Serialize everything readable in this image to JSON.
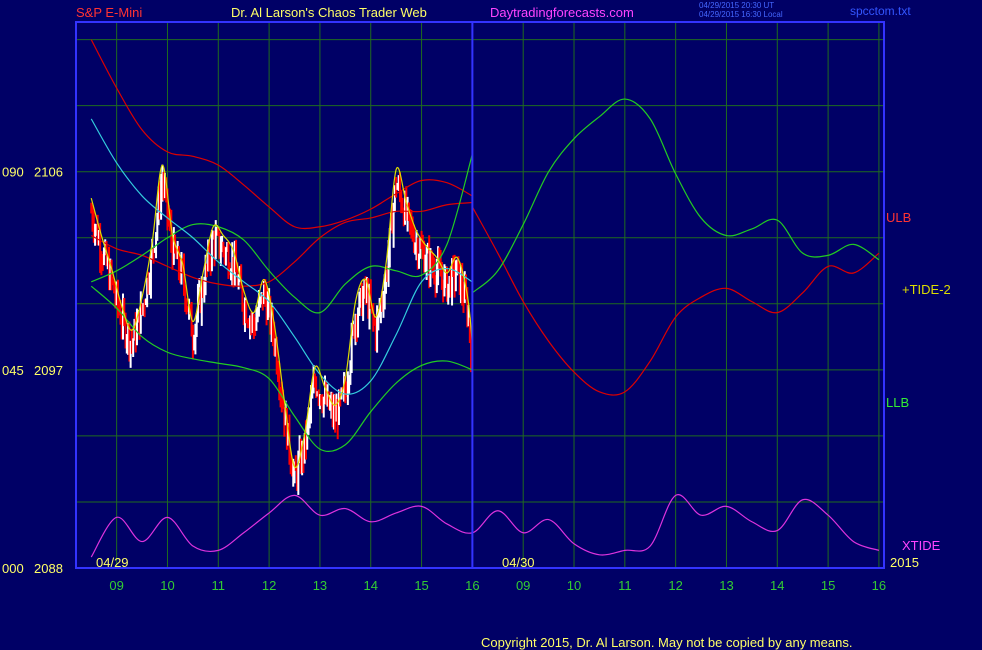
{
  "header": {
    "symbol": "S&P E-Mini",
    "title": "Dr. Al Larson's Chaos Trader Web",
    "site": "Daytradingforecasts.com",
    "stamp_line1": "04/29/2015 20:30 UT",
    "stamp_line2": "04/29/2015 16:30 Local",
    "filename": "spcctom.txt"
  },
  "footer": {
    "copyright": "Copyright 2015, Dr. Al Larson. May not be copied by any means."
  },
  "colors": {
    "background": "#000066",
    "frame": "#3333ff",
    "grid": "#1f6b1f",
    "red_line": "#dd0000",
    "green_line": "#22cc22",
    "cyan_line": "#33ccdd",
    "yellow_line": "#dddd00",
    "magenta_line": "#dd33dd",
    "bar_up": "#ffffff",
    "bar_down": "#ff0000",
    "time_labels": "#33cc33"
  },
  "chart_data": {
    "type": "line",
    "y_axis_labels": [
      {
        "left": "090",
        "right": "2106"
      },
      {
        "left": "045",
        "right": "2097"
      },
      {
        "left": "000",
        "right": "2088"
      }
    ],
    "ylim": [
      2088,
      2112.8
    ],
    "x_hour_labels": [
      "09",
      "10",
      "11",
      "12",
      "13",
      "14",
      "15",
      "16",
      "09",
      "10",
      "11",
      "12",
      "13",
      "14",
      "15",
      "16"
    ],
    "date_labels": [
      "04/29",
      "04/30",
      "2015"
    ],
    "series_labels": {
      "ulb": "ULB",
      "llb": "LLB",
      "tide": "+TIDE-2",
      "xtide": "XTIDE"
    },
    "series": [
      {
        "name": "ULB",
        "x": [
          8.5,
          9,
          9.5,
          10,
          10.5,
          11,
          11.5,
          12,
          12.5,
          13,
          13.5,
          14,
          14.5,
          15,
          15.5,
          16
        ],
        "y": [
          2112.0,
          2109.8,
          2107.9,
          2106.9,
          2106.7,
          2106.3,
          2105.4,
          2104.4,
          2103.5,
          2103.5,
          2103.8,
          2104.3,
          2105.0,
          2105.6,
          2105.5,
          2104.9
        ]
      },
      {
        "name": "Projection (red)",
        "x": [
          16,
          16.5,
          17,
          17.5,
          18,
          18.5,
          19,
          19.5,
          20,
          20.5,
          21,
          21.5,
          22,
          22.5,
          23,
          23.5,
          24
        ],
        "y": [
          2104.4,
          2102.3,
          2100.1,
          2098.3,
          2096.9,
          2096.0,
          2096.0,
          2097.4,
          2099.4,
          2100.3,
          2100.7,
          2100.1,
          2099.6,
          2100.5,
          2101.7,
          2101.4,
          2102.3
        ]
      },
      {
        "name": "Projection (green)",
        "x": [
          16,
          16.5,
          17,
          17.5,
          18,
          18.5,
          19,
          19.5,
          20,
          20.5,
          21,
          21.5,
          22,
          22.5,
          23,
          23.5,
          24
        ],
        "y": [
          2100.5,
          2101.5,
          2103.6,
          2106.0,
          2107.5,
          2108.5,
          2109.3,
          2108.4,
          2105.9,
          2103.9,
          2103.1,
          2103.4,
          2103.8,
          2102.3,
          2102.2,
          2102.7,
          2102.0
        ]
      },
      {
        "name": "LLB",
        "x": [
          8.5,
          9,
          9.5,
          10,
          10.5,
          11,
          11.5,
          12,
          12.5,
          13,
          13.5,
          14,
          14.5,
          15,
          15.5,
          16
        ],
        "y": [
          2100.8,
          2099.8,
          2098.5,
          2097.8,
          2097.5,
          2097.3,
          2097.1,
          2096.6,
          2094.9,
          2093.4,
          2093.6,
          2095.1,
          2096.4,
          2097.2,
          2097.4,
          2097.0
        ]
      },
      {
        "name": "Inner red",
        "x": [
          8.5,
          9,
          9.5,
          10,
          10.5,
          11,
          11.5,
          12,
          12.5,
          13,
          13.5,
          14,
          14.5,
          15,
          15.5,
          16
        ],
        "y": [
          2103.1,
          2102.5,
          2102.2,
          2101.7,
          2101.2,
          2100.9,
          2100.8,
          2101.0,
          2101.9,
          2103.0,
          2103.7,
          2103.9,
          2104.2,
          2104.2,
          2104.5,
          2104.6
        ]
      },
      {
        "name": "Inner green",
        "x": [
          8.5,
          9,
          9.5,
          10,
          10.5,
          11,
          11.5,
          12,
          12.5,
          13,
          13.5,
          14,
          14.5,
          15,
          15.5,
          16
        ],
        "y": [
          2101.0,
          2101.5,
          2102.2,
          2103.0,
          2103.6,
          2103.5,
          2102.9,
          2101.5,
          2100.3,
          2099.6,
          2100.9,
          2101.7,
          2101.5,
          2101.3,
          2102.7,
          2106.8
        ]
      },
      {
        "name": "Cyan average",
        "x": [
          8.5,
          9,
          9.5,
          10,
          10.5,
          11,
          11.5,
          12,
          12.5,
          13,
          13.5,
          14,
          14.5,
          15,
          15.5,
          16
        ],
        "y": [
          2108.4,
          2106.4,
          2104.9,
          2103.9,
          2103.0,
          2101.9,
          2101.0,
          2100.1,
          2098.5,
          2096.8,
          2095.9,
          2096.5,
          2098.6,
          2101.0,
          2101.6,
          2101.0
        ]
      },
      {
        "name": "XTIDE",
        "x": [
          8.5,
          9,
          9.5,
          10,
          10.5,
          11,
          11.5,
          12,
          12.5,
          13,
          13.5,
          14,
          14.5,
          15,
          15.5,
          16,
          16.5,
          17,
          17.5,
          18,
          18.5,
          19,
          19.5,
          20,
          20.5,
          21,
          21.5,
          22,
          22.5,
          23,
          23.5,
          24
        ],
        "y": [
          2088.5,
          2090.3,
          2089.2,
          2090.3,
          2089.0,
          2088.8,
          2089.6,
          2090.5,
          2091.3,
          2090.4,
          2090.7,
          2090.1,
          2090.5,
          2090.8,
          2090.0,
          2089.6,
          2090.6,
          2089.6,
          2090.2,
          2089.1,
          2088.6,
          2088.8,
          2089.0,
          2091.3,
          2090.4,
          2090.8,
          2090.1,
          2089.7,
          2091.1,
          2090.4,
          2089.2,
          2088.8
        ]
      }
    ],
    "price_path": {
      "x": [
        8.5,
        8.7,
        8.9,
        9.1,
        9.3,
        9.5,
        9.7,
        9.9,
        10.1,
        10.3,
        10.5,
        10.7,
        10.9,
        11.1,
        11.3,
        11.5,
        11.7,
        11.9,
        12.1,
        12.3,
        12.5,
        12.7,
        12.9,
        13.1,
        13.3,
        13.5,
        13.7,
        13.9,
        14.1,
        14.3,
        14.5,
        14.7,
        14.9,
        15.1,
        15.3,
        15.5,
        15.7,
        15.9,
        16.0
      ],
      "y": [
        2104.2,
        2102.5,
        2101.0,
        2099.3,
        2098.2,
        2099.7,
        2102.2,
        2105.7,
        2102.5,
        2101.2,
        2098.6,
        2100.8,
        2102.9,
        2102.5,
        2101.8,
        2100.0,
        2099.0,
        2100.5,
        2098.5,
        2095.0,
        2092.0,
        2093.5,
        2096.5,
        2095.6,
        2094.8,
        2096.0,
        2099.5,
        2100.5,
        2098.8,
        2101.2,
        2105.5,
        2104.0,
        2102.7,
        2102.0,
        2101.5,
        2100.8,
        2101.5,
        2099.8,
        2097.6
      ]
    }
  }
}
